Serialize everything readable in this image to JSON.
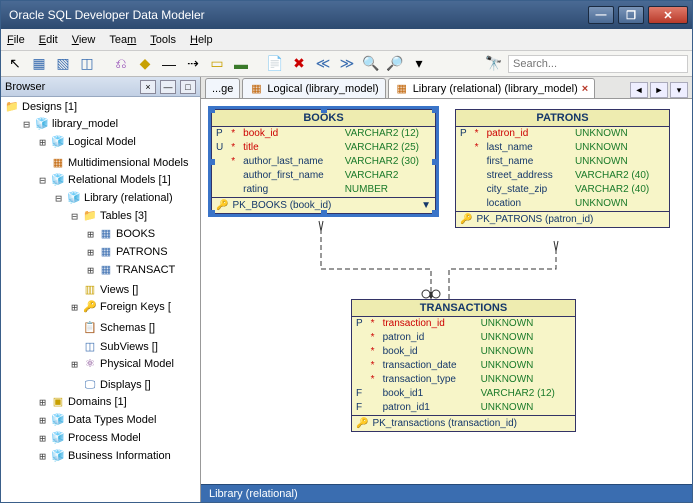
{
  "window": {
    "title": "Oracle SQL Developer Data Modeler"
  },
  "menu": {
    "file": "File",
    "edit": "Edit",
    "view": "View",
    "team": "Team",
    "tools": "Tools",
    "help": "Help"
  },
  "search": {
    "placeholder": "Search..."
  },
  "browser": {
    "title": "Browser",
    "root": "Designs [1]",
    "design": "library_model",
    "logical": "Logical Model",
    "multi": "Multidimensional Models",
    "relational": "Relational Models [1]",
    "library": "Library (relational)",
    "tables": "Tables [3]",
    "t1": "BOOKS",
    "t2": "PATRONS",
    "t3": "TRANSACT",
    "views": "Views []",
    "fks": "Foreign Keys [",
    "schemas": "Schemas []",
    "subviews": "SubViews []",
    "physical": "Physical Model",
    "displays": "Displays []",
    "domains": "Domains [1]",
    "dtm": "Data Types Model",
    "process": "Process Model",
    "business": "Business Information"
  },
  "tabs": {
    "t1": "...ge",
    "t2": "Logical (library_model)",
    "t3": "Library (relational) (library_model)"
  },
  "books": {
    "title": "BOOKS",
    "c1": {
      "flag": "P",
      "name": "book_id",
      "type": "VARCHAR2 (12)"
    },
    "c2": {
      "flag": "U",
      "name": "title",
      "type": "VARCHAR2 (25)"
    },
    "c3": {
      "name": "author_last_name",
      "type": "VARCHAR2 (30)"
    },
    "c4": {
      "name": "author_first_name",
      "type": "VARCHAR2"
    },
    "c5": {
      "name": "rating",
      "type": "NUMBER"
    },
    "pk": "PK_BOOKS (book_id)"
  },
  "patrons": {
    "title": "PATRONS",
    "c1": {
      "flag": "P",
      "name": "patron_id",
      "type": "UNKNOWN"
    },
    "c2": {
      "name": "last_name",
      "type": "UNKNOWN"
    },
    "c3": {
      "name": "first_name",
      "type": "UNKNOWN"
    },
    "c4": {
      "name": "street_address",
      "type": "VARCHAR2 (40)"
    },
    "c5": {
      "name": "city_state_zip",
      "type": "VARCHAR2 (40)"
    },
    "c6": {
      "name": "location",
      "type": "UNKNOWN"
    },
    "pk": "PK_PATRONS (patron_id)"
  },
  "trans": {
    "title": "TRANSACTIONS",
    "c1": {
      "flag": "P",
      "name": "transaction_id",
      "type": "UNKNOWN"
    },
    "c2": {
      "name": "patron_id",
      "type": "UNKNOWN"
    },
    "c3": {
      "name": "book_id",
      "type": "UNKNOWN"
    },
    "c4": {
      "name": "transaction_date",
      "type": "UNKNOWN"
    },
    "c5": {
      "name": "transaction_type",
      "type": "UNKNOWN"
    },
    "c6": {
      "flag": "F",
      "name": "book_id1",
      "type": "VARCHAR2 (12)"
    },
    "c7": {
      "flag": "F",
      "name": "patron_id1",
      "type": "UNKNOWN"
    },
    "pk": "PK_transactions (transaction_id)"
  },
  "status": "Library (relational)"
}
